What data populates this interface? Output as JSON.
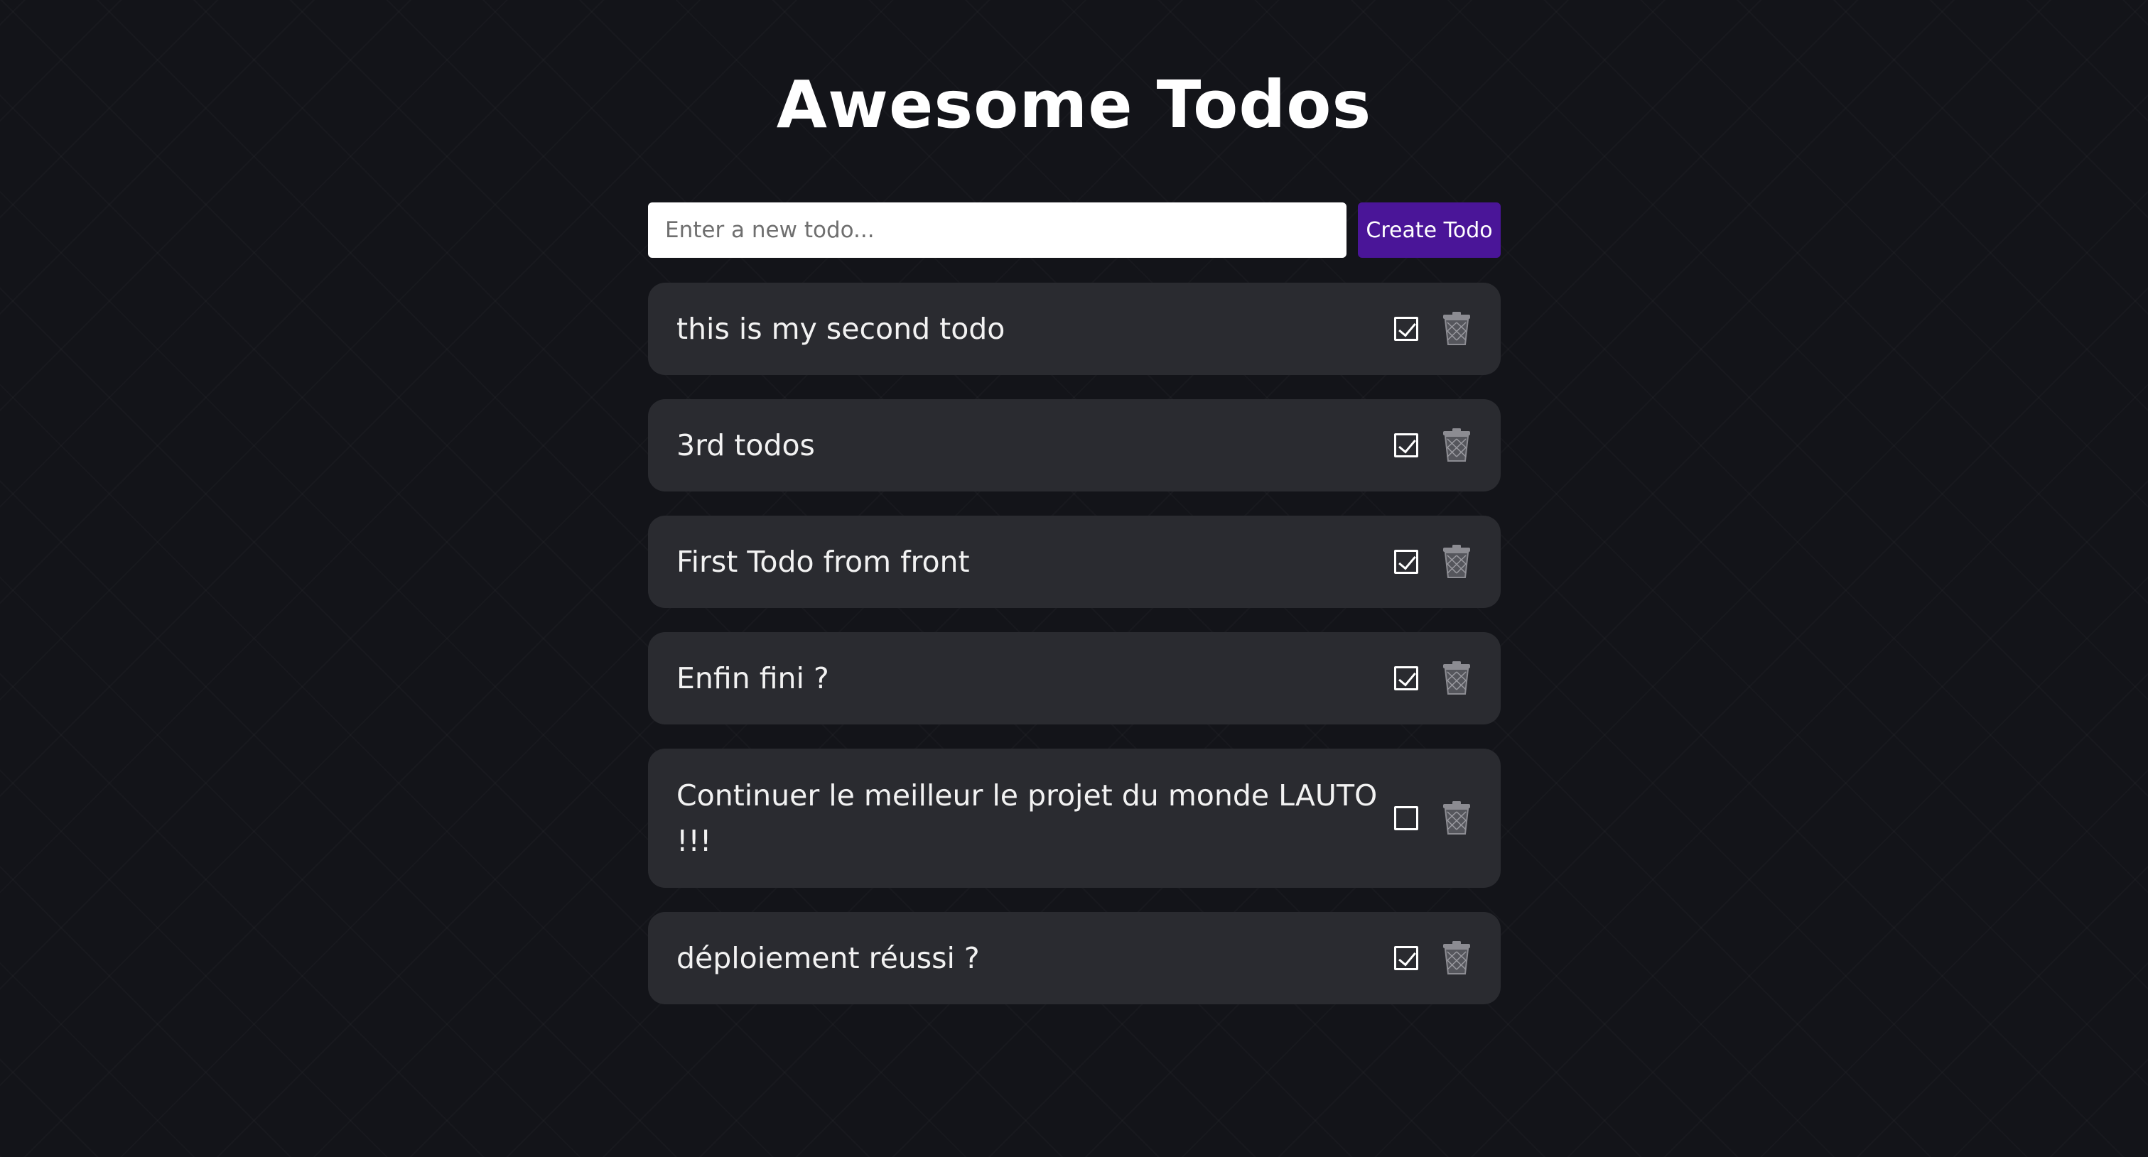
{
  "header": {
    "title": "Awesome Todos"
  },
  "form": {
    "placeholder": "Enter a new todo...",
    "value": "",
    "create_label": "Create Todo"
  },
  "colors": {
    "background": "#131419",
    "card": "#2a2b30",
    "accent": "#4a1598",
    "text": "#f2f2f2"
  },
  "todos": [
    {
      "text": "this is my second todo",
      "completed": true,
      "check_icon": "checkbox-checked-icon",
      "delete_icon": "trash-icon"
    },
    {
      "text": "3rd todos",
      "completed": true,
      "check_icon": "checkbox-checked-icon",
      "delete_icon": "trash-icon"
    },
    {
      "text": "First Todo from front",
      "completed": true,
      "check_icon": "checkbox-checked-icon",
      "delete_icon": "trash-icon"
    },
    {
      "text": "Enfin fini ?",
      "completed": true,
      "check_icon": "checkbox-checked-icon",
      "delete_icon": "trash-icon"
    },
    {
      "text": "Continuer le meilleur le projet du monde LAUTO !!!",
      "completed": false,
      "check_icon": "checkbox-empty-icon",
      "delete_icon": "trash-icon"
    },
    {
      "text": "déploiement réussi ?",
      "completed": true,
      "check_icon": "checkbox-checked-icon",
      "delete_icon": "trash-icon"
    }
  ]
}
